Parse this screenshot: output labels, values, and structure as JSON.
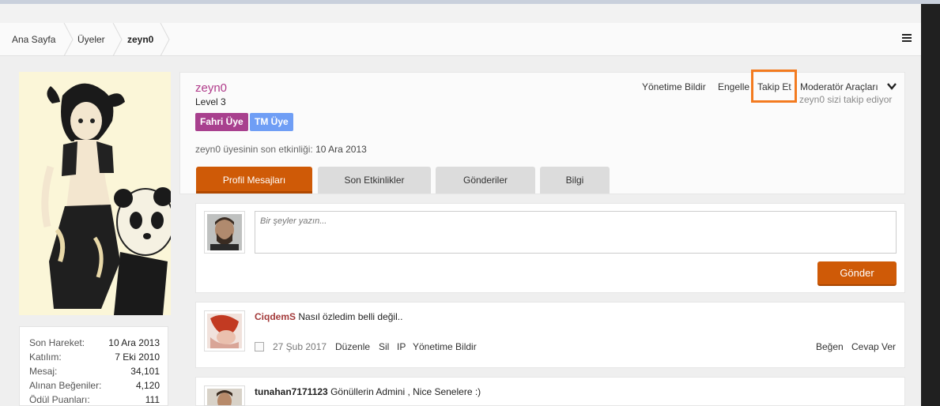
{
  "breadcrumb": {
    "items": [
      "Ana Sayfa",
      "Üyeler",
      "zeyn0"
    ]
  },
  "sidebar": {
    "stats": [
      {
        "label": "Son Hareket:",
        "value": "10 Ara 2013"
      },
      {
        "label": "Katılım:",
        "value": "7 Eki 2010"
      },
      {
        "label": "Mesaj:",
        "value": "34,101"
      },
      {
        "label": "Alınan Beğeniler:",
        "value": "4,120"
      },
      {
        "label": "Ödül Puanları:",
        "value": "111"
      }
    ]
  },
  "profile": {
    "username": "zeyn0",
    "level": "Level 3",
    "badges": [
      "Fahri Üye",
      "TM Üye"
    ],
    "activity_label": "zeyn0 üyesinin son etkinliği:",
    "activity_value": "10 Ara 2013",
    "actions": {
      "report": "Yönetime Bildir",
      "block": "Engelle",
      "follow": "Takip Et",
      "moderator": "Moderatör Araçları"
    },
    "follows_you": "zeyn0 sizi takip ediyor",
    "tabs": [
      "Profil Mesajları",
      "Son Etkinlikler",
      "Gönderiler",
      "Bilgi"
    ]
  },
  "composer": {
    "placeholder": "Bir şeyler yazın...",
    "submit_label": "Gönder"
  },
  "messages": [
    {
      "author": "CiqdemS",
      "text": "Nasıl özledim belli değil..",
      "date": "27 Şub 2017",
      "actions": [
        "Düzenle",
        "Sil",
        "IP",
        "Yönetime Bildir"
      ],
      "right_actions": [
        "Beğen",
        "Cevap Ver"
      ]
    },
    {
      "author": "tunahan7171123",
      "text": "Gönüllerin Admini , Nice Senelere :)",
      "date": "",
      "actions": [],
      "right_actions": []
    }
  ],
  "colors": {
    "accent": "#cf5a07",
    "username": "#b03a8a",
    "author": "#a33a3a",
    "badge_fahri": "#a8408e",
    "badge_tm": "#6f9ef5",
    "highlight": "#f37b20"
  }
}
